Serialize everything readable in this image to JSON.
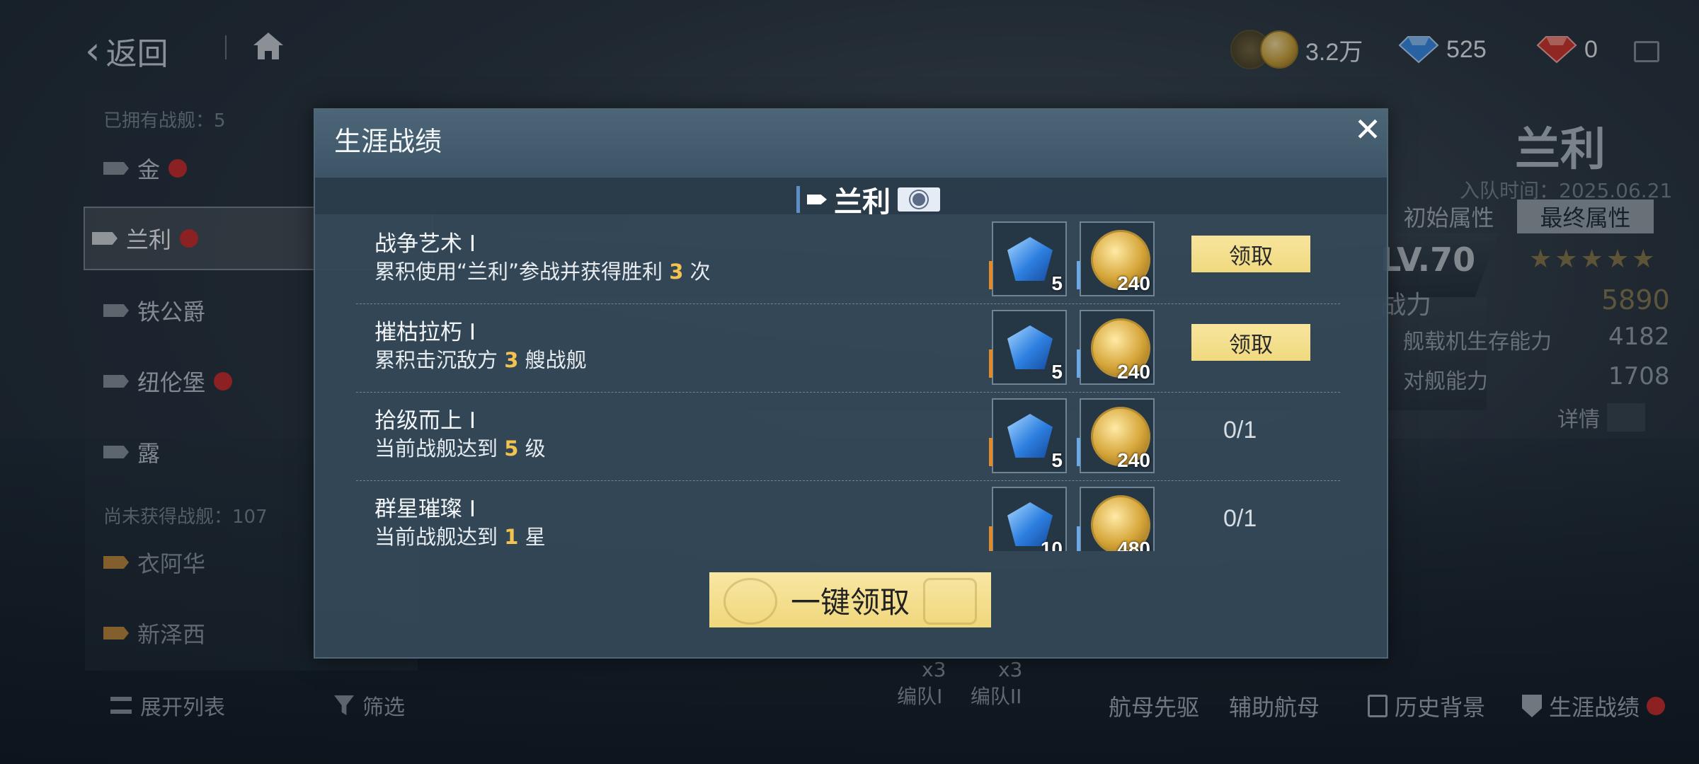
{
  "topbar": {
    "back_label": "返回",
    "currencies": [
      {
        "icon": "gold-coin-icon",
        "value": "3.2万"
      },
      {
        "icon": "blue-gem-icon",
        "value": "525"
      },
      {
        "icon": "red-gem-icon",
        "value": "0"
      }
    ]
  },
  "background": {
    "owned_label": "已拥有战舰：5",
    "owned_ships": [
      "金",
      "兰利",
      "铁公爵",
      "纽伦堡",
      "露"
    ],
    "unowned_label": "尚未获得战舰：107",
    "unowned_ships": [
      "衣阿华",
      "新泽西"
    ],
    "expand_list": "展开列表",
    "filter": "筛选",
    "ship_name": "兰利",
    "join_time": "入队时间：2025.06.21",
    "attr_tabs": [
      "初始属性",
      "最终属性"
    ],
    "level": "LV.70",
    "power_label": "战力",
    "power_value": "5890",
    "stats": [
      {
        "label": "舰载机生存能力",
        "value": "4182"
      },
      {
        "label": "对舰能力",
        "value": "1708"
      }
    ],
    "details": "详情",
    "fleet_slots": [
      {
        "count": "x3",
        "label": "编队I"
      },
      {
        "count": "x3",
        "label": "编队II"
      }
    ],
    "bottom_tabs": [
      "航母先驱",
      "辅助航母",
      "历史背景",
      "生涯战绩"
    ]
  },
  "modal": {
    "title": "生涯战绩",
    "ship_name": "兰利",
    "achievements": [
      {
        "title": "战争艺术 I",
        "desc_before": "累积使用“兰利”参战并获得胜利 ",
        "desc_num": "3",
        "desc_after": " 次",
        "gem": "5",
        "coin": "240",
        "action": "领取",
        "progress": ""
      },
      {
        "title": "摧枯拉朽 I",
        "desc_before": "累积击沉敌方 ",
        "desc_num": "3",
        "desc_after": " 艘战舰",
        "gem": "5",
        "coin": "240",
        "action": "领取",
        "progress": ""
      },
      {
        "title": "拾级而上 I",
        "desc_before": "当前战舰达到 ",
        "desc_num": "5",
        "desc_after": " 级",
        "gem": "5",
        "coin": "240",
        "action": "",
        "progress": "0/1"
      },
      {
        "title": "群星璀璨 I",
        "desc_before": "当前战舰达到 ",
        "desc_num": "1",
        "desc_after": " 星",
        "gem": "10",
        "coin": "480",
        "action": "",
        "progress": "0/1"
      }
    ],
    "claim_all": "一键领取"
  },
  "colors": {
    "claim_button": "#f0d97f",
    "highlight_number": "#f3c24f",
    "modal_bg": "#344858"
  }
}
